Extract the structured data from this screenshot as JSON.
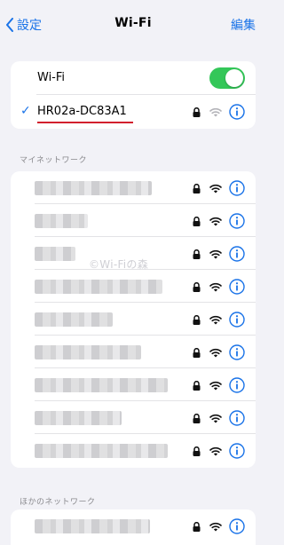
{
  "navbar": {
    "back_label": "設定",
    "title": "Wi-Fi",
    "edit_label": "編集"
  },
  "wifi_toggle": {
    "label": "Wi-Fi",
    "enabled": true
  },
  "connected": {
    "check": "✓",
    "ssid": "HR02a-DC83A1"
  },
  "sections": {
    "my_networks": "マイネットワーク",
    "other_networks": "ほかのネットワーク"
  },
  "watermark": "©Wi-Fiの森",
  "my_networks": {
    "items": [
      {
        "name_hidden": true,
        "secured": true
      },
      {
        "name_hidden": true,
        "secured": true
      },
      {
        "name_hidden": true,
        "secured": true
      },
      {
        "name_hidden": true,
        "secured": true
      },
      {
        "name_hidden": true,
        "secured": true
      },
      {
        "name_hidden": true,
        "secured": true
      },
      {
        "name_hidden": true,
        "secured": true
      },
      {
        "name_hidden": true,
        "secured": true
      },
      {
        "name_hidden": true,
        "secured": true
      }
    ]
  },
  "colors": {
    "accent": "#1a73e8",
    "toggle_on": "#34c759",
    "underline": "#d21f2d",
    "background": "#f2f2f7"
  },
  "icons": {
    "back": "chevron-left-icon",
    "lock": "lock-icon",
    "wifi": "wifi-icon",
    "info": "info-icon",
    "check": "checkmark-icon"
  }
}
